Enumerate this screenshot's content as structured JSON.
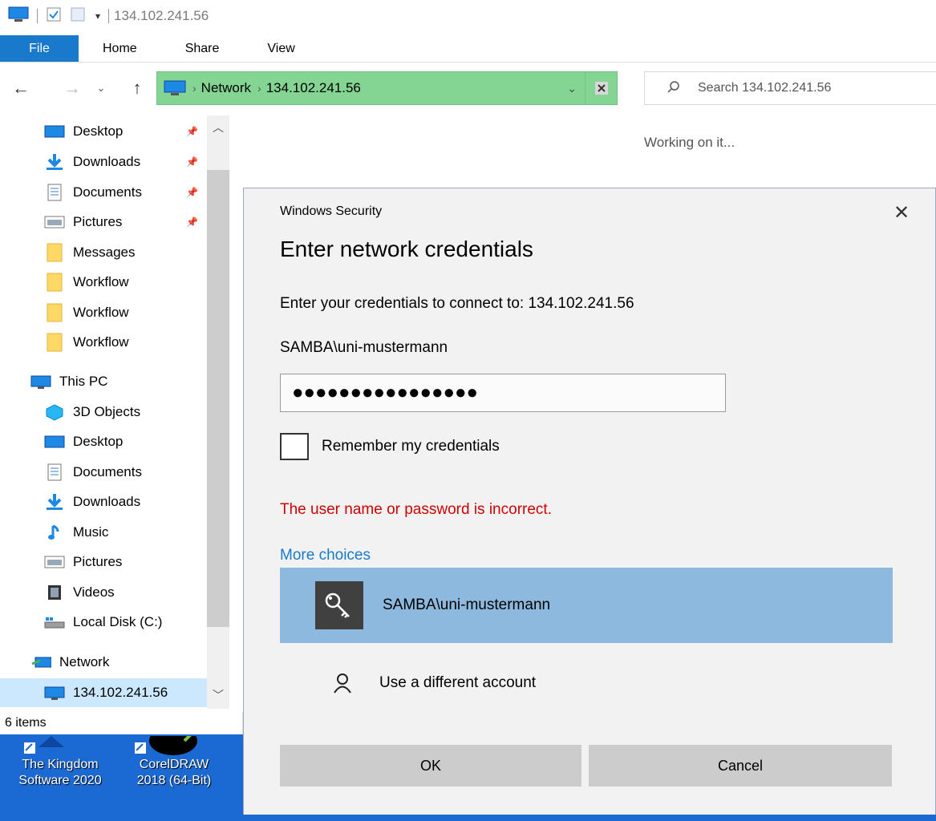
{
  "window": {
    "title": "134.102.241.56",
    "quick_access_icons": [
      "pc-icon",
      "properties-icon",
      "new-folder-icon",
      "customize-arrow-icon"
    ]
  },
  "ribbon": {
    "tabs": [
      {
        "label": "File",
        "active": true
      },
      {
        "label": "Home"
      },
      {
        "label": "Share"
      },
      {
        "label": "View"
      }
    ]
  },
  "address_bar": {
    "segments": [
      "Network",
      "134.102.241.56"
    ],
    "background_color": "#84d594"
  },
  "search": {
    "placeholder": "Search 134.102.241.56"
  },
  "nav_pane": {
    "quick_access": [
      {
        "label": "Desktop",
        "icon": "desktop-icon",
        "pinned": true
      },
      {
        "label": "Downloads",
        "icon": "download-icon",
        "pinned": true
      },
      {
        "label": "Documents",
        "icon": "documents-icon",
        "pinned": true
      },
      {
        "label": "Pictures",
        "icon": "pictures-icon",
        "pinned": true
      },
      {
        "label": "Messages",
        "icon": "folder-icon"
      },
      {
        "label": "Workflow",
        "icon": "folder-icon"
      },
      {
        "label": "Workflow",
        "icon": "folder-icon"
      },
      {
        "label": "Workflow",
        "icon": "folder-icon"
      }
    ],
    "this_pc": {
      "label": "This PC",
      "children": [
        {
          "label": "3D Objects",
          "icon": "3d-objects-icon"
        },
        {
          "label": "Desktop",
          "icon": "desktop-icon"
        },
        {
          "label": "Documents",
          "icon": "documents-icon"
        },
        {
          "label": "Downloads",
          "icon": "download-icon"
        },
        {
          "label": "Music",
          "icon": "music-icon"
        },
        {
          "label": "Pictures",
          "icon": "pictures-icon"
        },
        {
          "label": "Videos",
          "icon": "videos-icon"
        },
        {
          "label": "Local Disk (C:)",
          "icon": "drive-icon"
        }
      ]
    },
    "network": {
      "label": "Network",
      "children": [
        {
          "label": "134.102.241.56",
          "selected": true
        }
      ]
    }
  },
  "content": {
    "status_text": "Working on it..."
  },
  "status_bar": {
    "items_count": "6 items"
  },
  "desktop_icons": [
    {
      "label_line1": "The Kingdom",
      "label_line2": "Software 2020"
    },
    {
      "label_line1": "CorelDRAW",
      "label_line2": "2018 (64-Bit)"
    }
  ],
  "dialog": {
    "title": "Windows Security",
    "heading": "Enter network credentials",
    "subtitle": "Enter your credentials to connect to: 134.102.241.56",
    "username": "SAMBA\\uni-mustermann",
    "password_masked": "●●●●●●●●●●●●●●●●",
    "remember_label": "Remember my credentials",
    "remember_checked": false,
    "error": "The user name or password is incorrect.",
    "more_choices": "More choices",
    "choices": [
      {
        "label": "SAMBA\\uni-mustermann",
        "icon": "key-icon",
        "selected": true
      },
      {
        "label": "Use a different account",
        "icon": "user-icon"
      }
    ],
    "ok_label": "OK",
    "cancel_label": "Cancel",
    "error_color": "#d00000",
    "link_color": "#1979ca",
    "selected_color": "#8db9df"
  }
}
